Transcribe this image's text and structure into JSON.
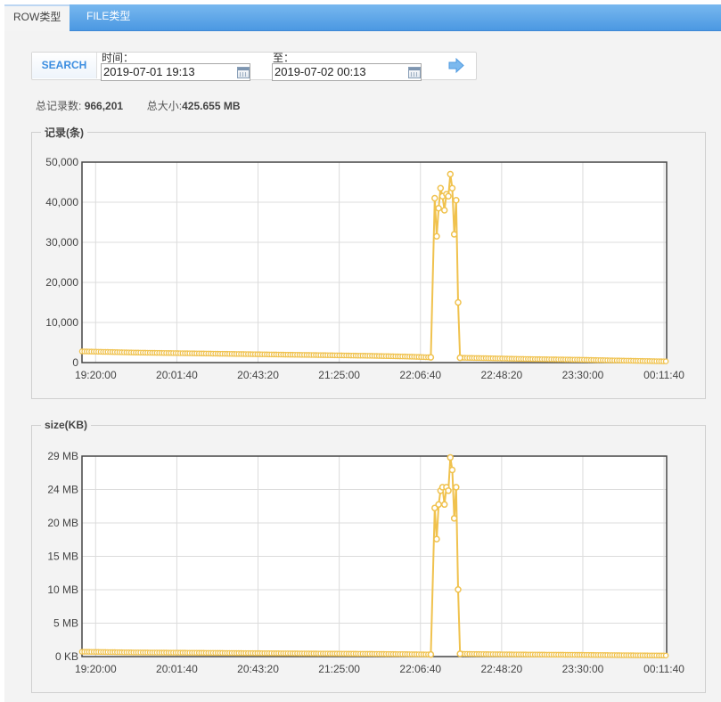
{
  "tabs": [
    {
      "label": "ROW类型",
      "active": true
    },
    {
      "label": "FILE类型",
      "active": false
    }
  ],
  "search": {
    "button_label": "SEARCH",
    "from_label": "时间：",
    "from_value": "2019-07-01 19:13",
    "to_label": "至：",
    "to_value": "2019-07-02 00:13"
  },
  "stats": {
    "records_label": "总记录数:",
    "records_value": "966,201",
    "size_label": "总大小:",
    "size_value": "425.655 MB"
  },
  "colors": {
    "tabbar": "#4b98e2",
    "series": "#f0c24e",
    "button_text": "#3d8ee0"
  },
  "chart_data": [
    {
      "type": "line",
      "title": "记录(条)",
      "xlabel": "",
      "ylabel": "",
      "x_tick_labels": [
        "19:20:00",
        "20:01:40",
        "20:43:20",
        "21:25:00",
        "22:06:40",
        "22:48:20",
        "23:30:00",
        "00:11:40"
      ],
      "y_tick_labels": [
        "0",
        "10,000",
        "20,000",
        "30,000",
        "40,000",
        "50,000"
      ],
      "ylim": [
        0,
        50000
      ],
      "grid": true,
      "series": [
        {
          "points": [
            [
              "19:13",
              2800
            ],
            [
              "19:40",
              2500
            ],
            [
              "20:10",
              2300
            ],
            [
              "20:40",
              2100
            ],
            [
              "21:10",
              1900
            ],
            [
              "21:40",
              1700
            ],
            [
              "22:00",
              1500
            ],
            [
              "22:12",
              1300
            ],
            [
              "22:14",
              41000
            ],
            [
              "22:15",
              31500
            ],
            [
              "22:16",
              38500
            ],
            [
              "22:17",
              43500
            ],
            [
              "22:18",
              41500
            ],
            [
              "22:19",
              38000
            ],
            [
              "22:20",
              42000
            ],
            [
              "22:21",
              41500
            ],
            [
              "22:22",
              47000
            ],
            [
              "22:23",
              43500
            ],
            [
              "22:24",
              32000
            ],
            [
              "22:25",
              40500
            ],
            [
              "22:26",
              15000
            ],
            [
              "22:27",
              1200
            ],
            [
              "22:40",
              1100
            ],
            [
              "23:00",
              900
            ],
            [
              "23:30",
              700
            ],
            [
              "23:50",
              500
            ],
            [
              "00:13",
              300
            ]
          ]
        }
      ]
    },
    {
      "type": "line",
      "title": "size(KB)",
      "xlabel": "",
      "ylabel": "",
      "x_tick_labels": [
        "19:20:00",
        "20:01:40",
        "20:43:20",
        "21:25:00",
        "22:06:40",
        "22:48:20",
        "23:30:00",
        "00:11:40"
      ],
      "y_tick_labels": [
        "0 KB",
        "5 MB",
        "10 MB",
        "15 MB",
        "20 MB",
        "24 MB",
        "29 MB"
      ],
      "ylim": [
        0,
        29
      ],
      "grid": true,
      "series": [
        {
          "points": [
            [
              "19:13",
              0.7
            ],
            [
              "19:40",
              0.6
            ],
            [
              "20:10",
              0.55
            ],
            [
              "20:40",
              0.5
            ],
            [
              "21:10",
              0.45
            ],
            [
              "21:40",
              0.4
            ],
            [
              "22:00",
              0.35
            ],
            [
              "22:12",
              0.3
            ],
            [
              "22:14",
              21.5
            ],
            [
              "22:15",
              17.0
            ],
            [
              "22:16",
              22.0
            ],
            [
              "22:17",
              24.0
            ],
            [
              "22:18",
              24.5
            ],
            [
              "22:19",
              22.0
            ],
            [
              "22:20",
              24.5
            ],
            [
              "22:21",
              24.0
            ],
            [
              "22:22",
              28.8
            ],
            [
              "22:23",
              27.0
            ],
            [
              "22:24",
              20.0
            ],
            [
              "22:25",
              24.5
            ],
            [
              "22:26",
              9.7
            ],
            [
              "22:27",
              0.4
            ],
            [
              "22:40",
              0.35
            ],
            [
              "23:00",
              0.3
            ],
            [
              "23:30",
              0.25
            ],
            [
              "23:50",
              0.2
            ],
            [
              "00:13",
              0.15
            ]
          ]
        }
      ]
    }
  ]
}
